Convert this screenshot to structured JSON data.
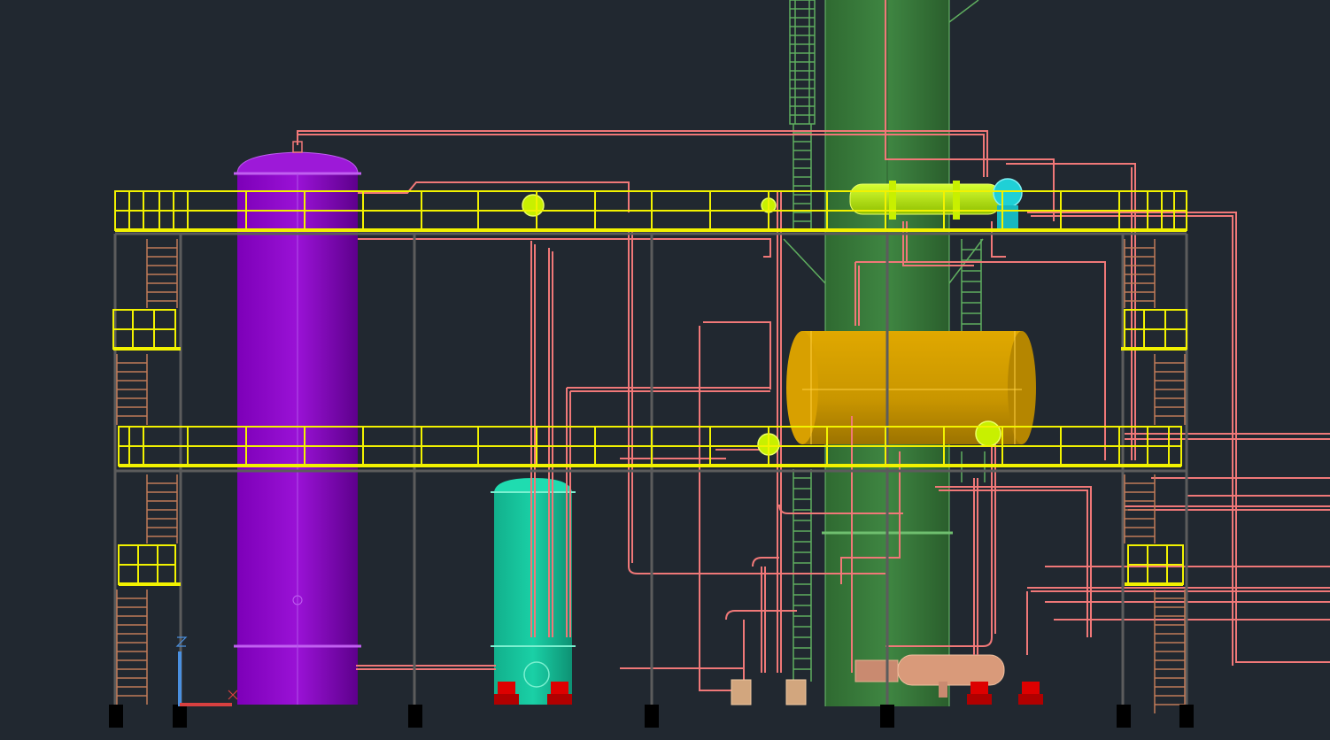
{
  "viewport": {
    "background": "#212830",
    "colors": {
      "vessel_purple": "#8a00c4",
      "vessel_teal": "#14c39a",
      "column_green": "#3a7a3c",
      "drum_gold": "#c99600",
      "exchanger_yellow_green": "#b8e600",
      "exchanger_cyan": "#1fd0d6",
      "platform_yellow": "#f2f200",
      "piping_salmon": "#f07878",
      "ladder_brown": "#c07a58",
      "ladder_green": "#5fae5f",
      "pump_red": "#dd0000",
      "steel_gray": "#5c5c5c",
      "footing_black": "#000000",
      "ucs_x_red": "#d84040",
      "ucs_y_blue": "#4a90e0"
    },
    "icons": [
      "ucs-axis-icon"
    ]
  }
}
